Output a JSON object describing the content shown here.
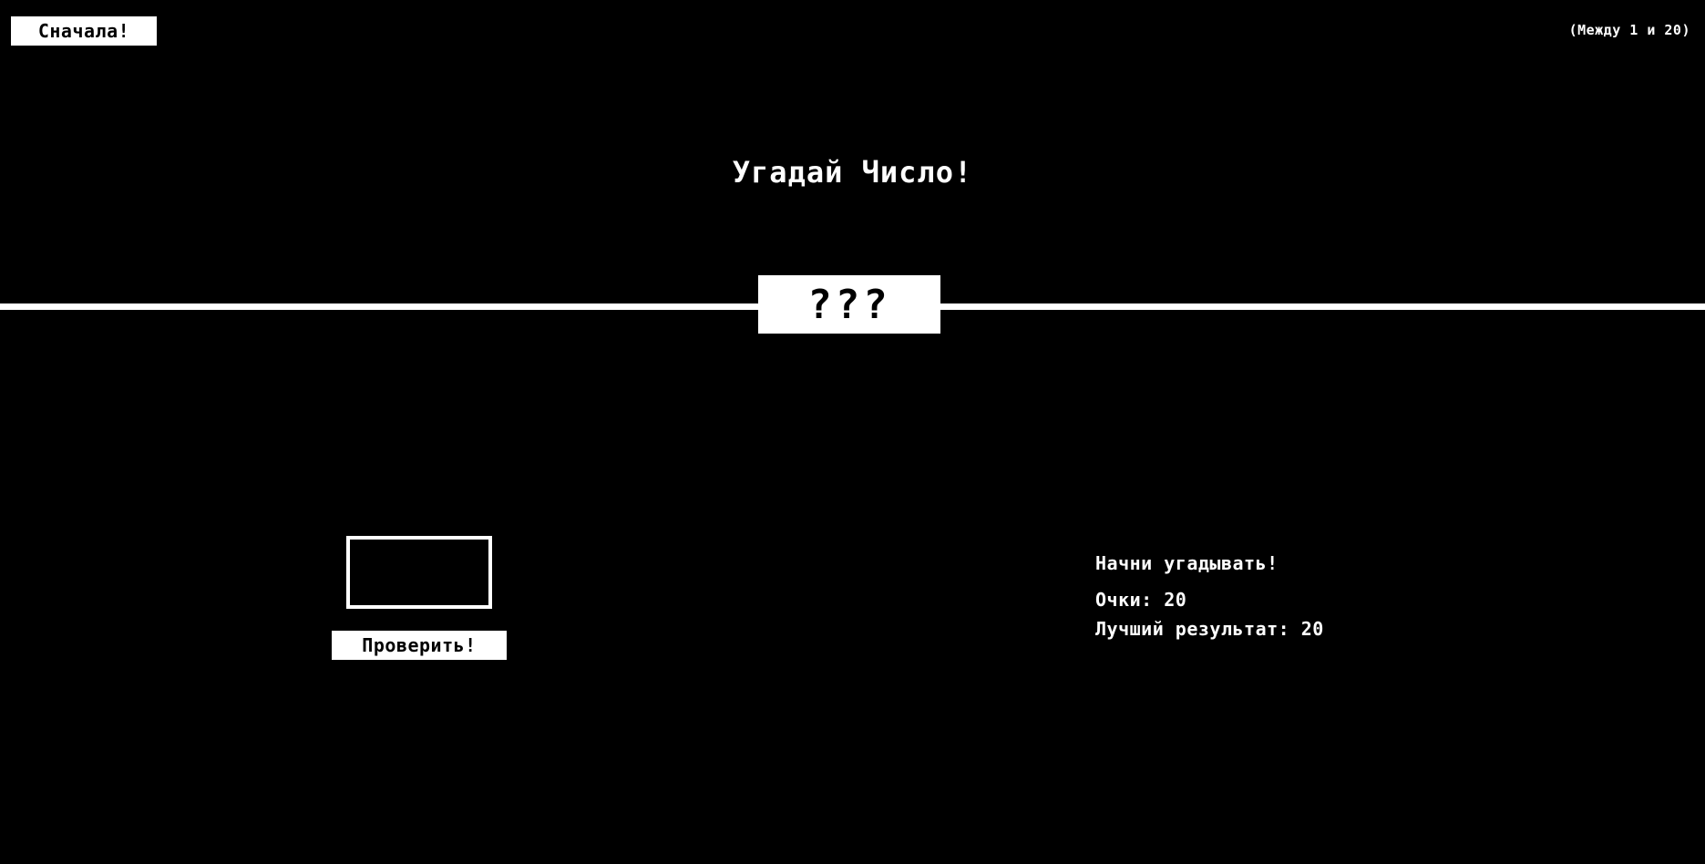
{
  "header": {
    "again_label": "Сначала!",
    "range_text": "(Между 1 и 20)"
  },
  "title": "Угадай Число!",
  "secret": "???",
  "guess": {
    "value": "",
    "placeholder": ""
  },
  "check_label": "Проверить!",
  "status": {
    "message": "Начни угадывать!",
    "score_label": "Очки:",
    "score_value": "20",
    "highscore_label": "Лучший результат:",
    "highscore_value": "20"
  },
  "colors": {
    "background": "#000000",
    "foreground": "#ffffff"
  }
}
